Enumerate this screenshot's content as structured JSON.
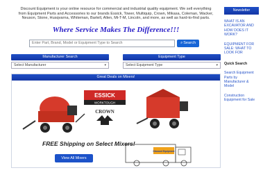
{
  "intro_text": "Discount Equipment is your online resource for commercial and industrial quality equipment. We sell everything from Equipment Parts and Accessories to our brands Essick, Tower, Multiquip, Crown, Mikasa, Coleman, Wacker, Neuson, Stone, Husqvarna, Whiteman, Bartell, Allen, Mi-T-M, Lincoln, and more, as well as hard-to-find parts.",
  "tagline": "Where Service Makes The Difference!!!",
  "search": {
    "placeholder": "Enter Part, Brand, Model or Equipment Type to Search",
    "button_label": "Search"
  },
  "filters": [
    {
      "heading": "Manufacturer Search",
      "selected": "Select Manufacturer"
    },
    {
      "heading": "Equipment Type",
      "selected": "Select Equipment Type"
    }
  ],
  "featured": {
    "heading": "Great Deals on Mixers!",
    "shipping_text": "FREE Shipping on Select Mixers!",
    "button_label": "View All Mixers",
    "logo_brand": "ESSICK",
    "logo_sub": "WORKTOUGH",
    "logo_crown": "CROWN",
    "truck_brand": "Discount Equipment"
  },
  "sidebar": {
    "heading": "Newsletter",
    "links": [
      "WHAT IS AN EXCAVATOR AND HOW DOES IT WORK?",
      "EQUIPMENT FOR SALE: WHAT TO LOOK FOR"
    ],
    "subheading": "Quick Search",
    "links2": [
      "Search Equipment Parts by Manufacturer & Model",
      "Construction Equipment for Sale"
    ]
  },
  "colors": {
    "header_blue": "#1a43b8",
    "button_blue": "#1765d6",
    "tagline_blue": "#2a1fc7",
    "mixer_red": "#d63a2b",
    "logo_red": "#cf2a27"
  }
}
